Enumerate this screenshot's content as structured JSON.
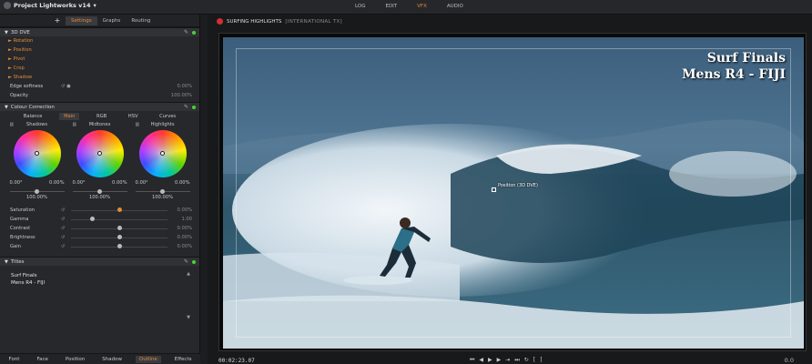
{
  "app": {
    "title": "Project Lightworks v14"
  },
  "topnav": {
    "items": [
      "LOG",
      "EDIT",
      "VFX",
      "AUDIO"
    ],
    "active": "VFX"
  },
  "panel_tabs": {
    "plus": "+",
    "items": [
      "Settings",
      "Graphs",
      "Routing"
    ],
    "active": "Settings"
  },
  "dve": {
    "header": "3D DVE",
    "items": [
      "Rotation",
      "Position",
      "Pivot",
      "Crop",
      "Shadow"
    ],
    "props": [
      {
        "label": "Edge softness",
        "value": ""
      },
      {
        "label": "Opacity",
        "value": "100.00%"
      }
    ],
    "edge_value": "0.00%"
  },
  "cc": {
    "header": "Colour Correction",
    "tabs": [
      "Balance",
      "Main",
      "RGB",
      "HSV",
      "Curves"
    ],
    "active": "Main",
    "wheels": [
      {
        "label": "Shadows",
        "hue": "0.00°",
        "sat": "0.00%",
        "pct": "100.00%"
      },
      {
        "label": "Midtones",
        "hue": "0.00°",
        "sat": "0.00%",
        "pct": "100.00%"
      },
      {
        "label": "Highlights",
        "hue": "0.00°",
        "sat": "0.00%",
        "pct": "100.00%"
      }
    ],
    "sliders": [
      {
        "label": "Saturation",
        "value": "0.00%",
        "level": 0.5
      },
      {
        "label": "Gamma",
        "value": "1.00",
        "level": 0.22
      },
      {
        "label": "Contrast",
        "value": "0.00%",
        "level": 0.5
      },
      {
        "label": "Brightness",
        "value": "0.00%",
        "level": 0.5
      },
      {
        "label": "Gain",
        "value": "0.00%",
        "level": 0.5
      }
    ]
  },
  "titles": {
    "header": "Titles",
    "line1": "Surf Finals",
    "line2": "Mens R4 - FIJI"
  },
  "bottom_tabs": {
    "items": [
      "Font",
      "Face",
      "Position",
      "Shadow",
      "Outline",
      "Effects"
    ],
    "active": "Outline"
  },
  "viewer": {
    "title": "SURFING HIGHLIGHTS",
    "subtitle": "[INTERNATIONAL TX]",
    "overlay_line1": "Surf Finals",
    "overlay_line2": "Mens R4 - FIJI",
    "position_label": "Position (3D DVE)",
    "timecode": "00:02:23.07",
    "end": "0.0"
  },
  "colors": {
    "accent": "#e38a3a",
    "active_dot": "#4bd13b",
    "rec": "#d32f2f"
  }
}
